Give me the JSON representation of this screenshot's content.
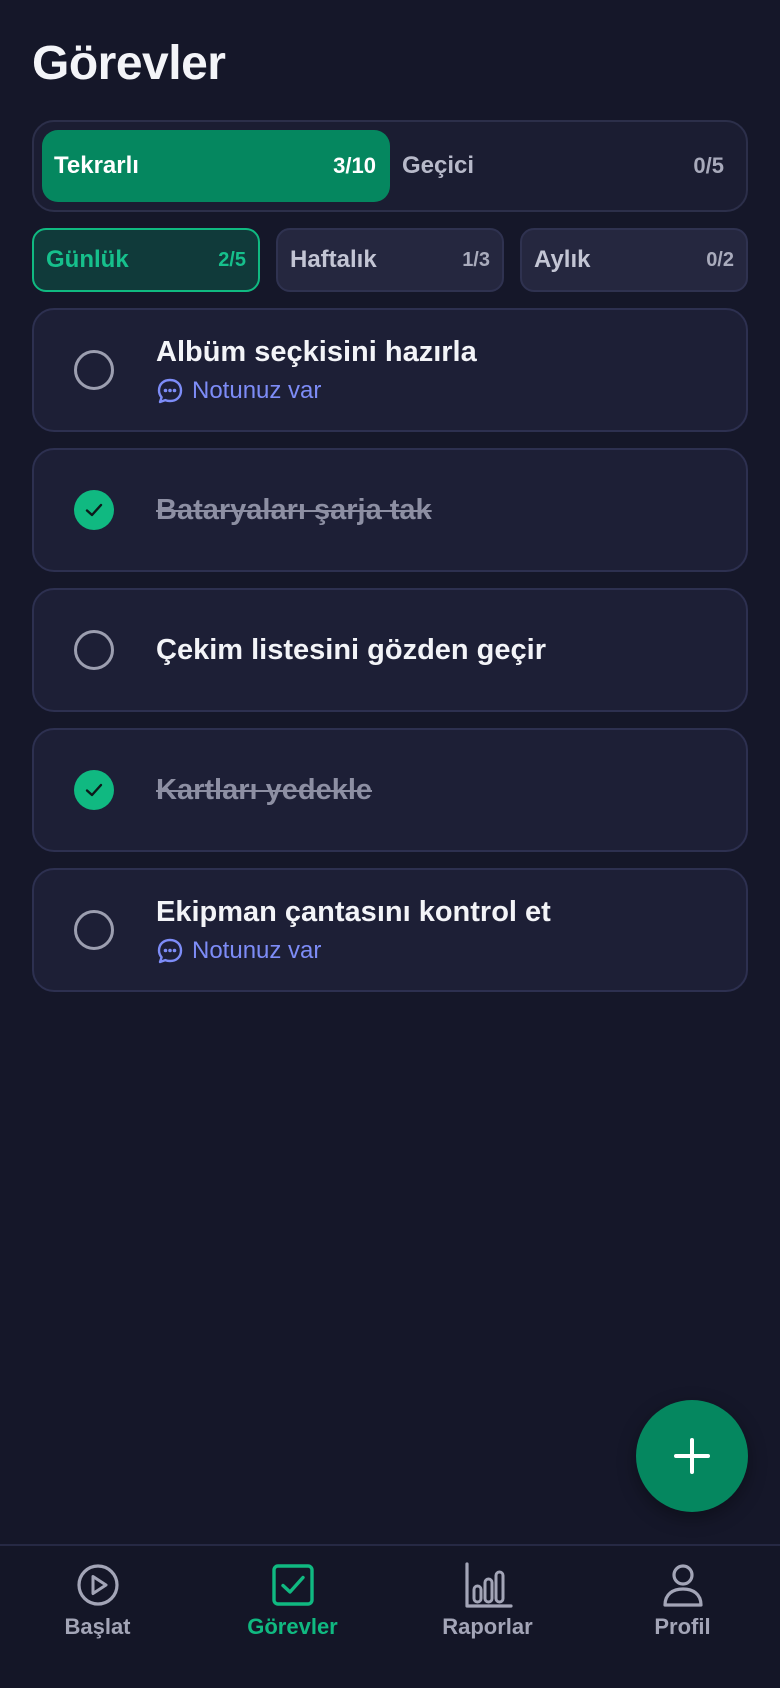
{
  "header": {
    "title": "Görevler"
  },
  "main_tabs": [
    {
      "label": "Tekrarlı",
      "count": "3/10",
      "active": true
    },
    {
      "label": "Geçici",
      "count": "0/5",
      "active": false
    }
  ],
  "sub_tabs": [
    {
      "label": "Günlük",
      "count": "2/5",
      "active": true
    },
    {
      "label": "Haftalık",
      "count": "1/3",
      "active": false
    },
    {
      "label": "Aylık",
      "count": "0/2",
      "active": false
    }
  ],
  "tasks": [
    {
      "title": "Albüm seçkisini hazırla",
      "done": false,
      "note": "Notunuz var"
    },
    {
      "title": "Bataryaları şarja tak",
      "done": true
    },
    {
      "title": "Çekim listesini gözden geçir",
      "done": false
    },
    {
      "title": "Kartları yedekle",
      "done": true
    },
    {
      "title": "Ekipman çantasını kontrol et",
      "done": false,
      "note": "Notunuz var"
    }
  ],
  "fab": {
    "icon": "plus-icon"
  },
  "bottom_nav": [
    {
      "label": "Başlat",
      "icon": "play-circle-icon",
      "active": false
    },
    {
      "label": "Görevler",
      "icon": "checkbox-icon",
      "active": true
    },
    {
      "label": "Raporlar",
      "icon": "bar-chart-icon",
      "active": false
    },
    {
      "label": "Profil",
      "icon": "user-icon",
      "active": false
    }
  ],
  "colors": {
    "background": "#151729",
    "accent": "#05875f",
    "accent_bright": "#10b981",
    "note": "#7d8cf7"
  }
}
